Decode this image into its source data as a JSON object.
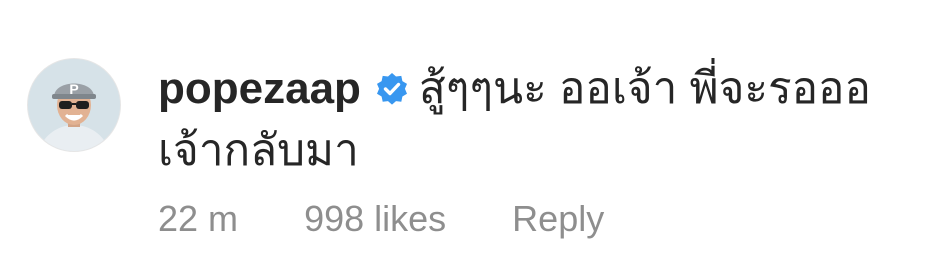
{
  "comment": {
    "username": "popezaap",
    "verified_icon": "verified-badge-icon",
    "text": "สู้ๆๆนะ ออเจ้า พี่จะรอออ เจ้ากลับมา",
    "time": "22 m",
    "likes": "998 likes",
    "reply_label": "Reply"
  },
  "colors": {
    "text": "#262626",
    "meta": "#8e8e8e",
    "verified": "#3897f0"
  }
}
